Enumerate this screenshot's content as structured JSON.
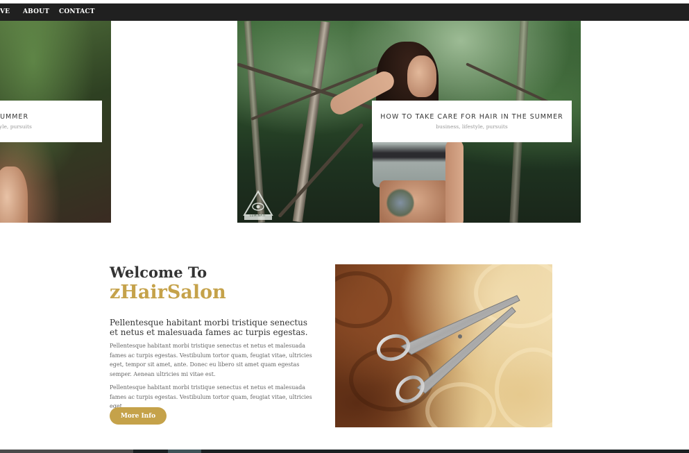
{
  "nav": {
    "items": [
      {
        "label": "VE"
      },
      {
        "label": "ABOUT"
      },
      {
        "label": "CONTACT"
      }
    ]
  },
  "slider": {
    "slides": [
      {
        "title": "OR HAIR IN THE SUMMER",
        "tags": "style, pursuits"
      },
      {
        "title": "HOW TO TAKE CARE FOR HAIR IN THE SUMMER",
        "tags": "business, lifestyle, pursuits",
        "watermark": "LUMINATI"
      }
    ]
  },
  "welcome": {
    "line1": "Welcome To",
    "line2": "zHairSalon",
    "lead": "Pellentesque habitant morbi tristique senectus et netus et malesuada fames ac turpis egestas.",
    "para1": "Pellentesque habitant morbi tristique senectus et netus et malesuada fames ac turpis egestas. Vestibulum tortor quam, feugiat vitae, ultricies eget, tempor sit amet, ante. Donec eu libero sit amet quam egestas semper. Aenean ultricies mi vitae est.",
    "para2": "Pellentesque habitant morbi tristique senectus et netus et malesuada fames ac turpis egestas. Vestibulum tortor quam, feugiat vitae, ultricies eget.",
    "button_label": "More Info"
  },
  "colors": {
    "accent": "#c5a24a",
    "navbar": "#202020",
    "heading": "#333333",
    "body_text": "#666666"
  },
  "icons": {
    "watermark": "eye-triangle-icon"
  }
}
